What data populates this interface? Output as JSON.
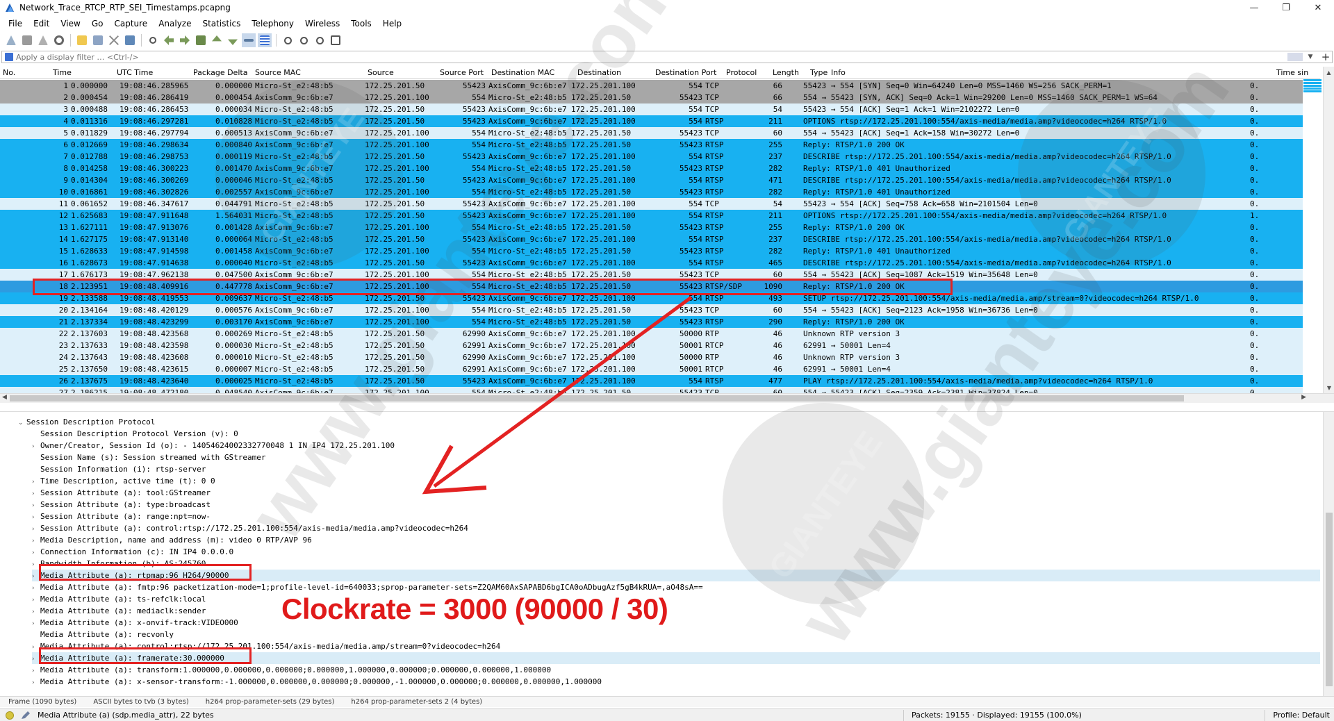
{
  "window": {
    "title": "Network_Trace_RTCP_RTP_SEI_Timestamps.pcapng",
    "controls": [
      "—",
      "❐",
      "✕"
    ]
  },
  "menu": [
    "File",
    "Edit",
    "View",
    "Go",
    "Capture",
    "Analyze",
    "Statistics",
    "Telephony",
    "Wireless",
    "Tools",
    "Help"
  ],
  "filter": {
    "placeholder": "Apply a display filter … <Ctrl-/>"
  },
  "columns": [
    "No.",
    "Time",
    "UTC Time",
    "Package Delta",
    "Source MAC",
    "Source",
    "Source Port",
    "Destination MAC",
    "Destination",
    "Destination Port",
    "Protocol",
    "Length",
    "Type",
    "Info",
    "Time sin"
  ],
  "packets": [
    {
      "no": "1",
      "time": "0.000000",
      "utc": "19:08:46.285965",
      "delta": "0.000000",
      "smac": "Micro-St_e2:48:b5",
      "src": "172.25.201.50",
      "sport": "55423",
      "dmac": "AxisComm_9c:6b:e7",
      "dst": "172.25.201.100",
      "dport": "554",
      "proto": "TCP",
      "len": "66",
      "type": "",
      "info": "55423 → 554 [SYN] Seq=0 Win=64240 Len=0 MSS=1460 WS=256 SACK_PERM=1",
      "tsince": "0.",
      "style": "gray"
    },
    {
      "no": "2",
      "time": "0.000454",
      "utc": "19:08:46.286419",
      "delta": "0.000454",
      "smac": "AxisComm_9c:6b:e7",
      "src": "172.25.201.100",
      "sport": "554",
      "dmac": "Micro-St_e2:48:b5",
      "dst": "172.25.201.50",
      "dport": "55423",
      "proto": "TCP",
      "len": "66",
      "type": "",
      "info": "554 → 55423 [SYN, ACK] Seq=0 Ack=1 Win=29200 Len=0 MSS=1460 SACK_PERM=1 WS=64",
      "tsince": "0.",
      "style": "gray"
    },
    {
      "no": "3",
      "time": "0.000488",
      "utc": "19:08:46.286453",
      "delta": "0.000034",
      "smac": "Micro-St_e2:48:b5",
      "src": "172.25.201.50",
      "sport": "55423",
      "dmac": "AxisComm_9c:6b:e7",
      "dst": "172.25.201.100",
      "dport": "554",
      "proto": "TCP",
      "len": "54",
      "type": "",
      "info": "55423 → 554 [ACK] Seq=1 Ack=1 Win=2102272 Len=0",
      "tsince": "0.",
      "style": "light"
    },
    {
      "no": "4",
      "time": "0.011316",
      "utc": "19:08:46.297281",
      "delta": "0.010828",
      "smac": "Micro-St_e2:48:b5",
      "src": "172.25.201.50",
      "sport": "55423",
      "dmac": "AxisComm_9c:6b:e7",
      "dst": "172.25.201.100",
      "dport": "554",
      "proto": "RTSP",
      "len": "211",
      "type": "",
      "info": "OPTIONS rtsp://172.25.201.100:554/axis-media/media.amp?videocodec=h264 RTSP/1.0",
      "tsince": "0.",
      "style": "blue"
    },
    {
      "no": "5",
      "time": "0.011829",
      "utc": "19:08:46.297794",
      "delta": "0.000513",
      "smac": "AxisComm_9c:6b:e7",
      "src": "172.25.201.100",
      "sport": "554",
      "dmac": "Micro-St_e2:48:b5",
      "dst": "172.25.201.50",
      "dport": "55423",
      "proto": "TCP",
      "len": "60",
      "type": "",
      "info": "554 → 55423 [ACK] Seq=1 Ack=158 Win=30272 Len=0",
      "tsince": "0.",
      "style": "light"
    },
    {
      "no": "6",
      "time": "0.012669",
      "utc": "19:08:46.298634",
      "delta": "0.000840",
      "smac": "AxisComm_9c:6b:e7",
      "src": "172.25.201.100",
      "sport": "554",
      "dmac": "Micro-St_e2:48:b5",
      "dst": "172.25.201.50",
      "dport": "55423",
      "proto": "RTSP",
      "len": "255",
      "type": "",
      "info": "Reply: RTSP/1.0 200 OK",
      "tsince": "0.",
      "style": "blue"
    },
    {
      "no": "7",
      "time": "0.012788",
      "utc": "19:08:46.298753",
      "delta": "0.000119",
      "smac": "Micro-St_e2:48:b5",
      "src": "172.25.201.50",
      "sport": "55423",
      "dmac": "AxisComm_9c:6b:e7",
      "dst": "172.25.201.100",
      "dport": "554",
      "proto": "RTSP",
      "len": "237",
      "type": "",
      "info": "DESCRIBE rtsp://172.25.201.100:554/axis-media/media.amp?videocodec=h264 RTSP/1.0",
      "tsince": "0.",
      "style": "blue"
    },
    {
      "no": "8",
      "time": "0.014258",
      "utc": "19:08:46.300223",
      "delta": "0.001470",
      "smac": "AxisComm_9c:6b:e7",
      "src": "172.25.201.100",
      "sport": "554",
      "dmac": "Micro-St_e2:48:b5",
      "dst": "172.25.201.50",
      "dport": "55423",
      "proto": "RTSP",
      "len": "282",
      "type": "",
      "info": "Reply: RTSP/1.0 401 Unauthorized",
      "tsince": "0.",
      "style": "blue"
    },
    {
      "no": "9",
      "time": "0.014304",
      "utc": "19:08:46.300269",
      "delta": "0.000046",
      "smac": "Micro-St_e2:48:b5",
      "src": "172.25.201.50",
      "sport": "55423",
      "dmac": "AxisComm_9c:6b:e7",
      "dst": "172.25.201.100",
      "dport": "554",
      "proto": "RTSP",
      "len": "471",
      "type": "",
      "info": "DESCRIBE rtsp://172.25.201.100:554/axis-media/media.amp?videocodec=h264 RTSP/1.0",
      "tsince": "0.",
      "style": "blue"
    },
    {
      "no": "10",
      "time": "0.016861",
      "utc": "19:08:46.302826",
      "delta": "0.002557",
      "smac": "AxisComm_9c:6b:e7",
      "src": "172.25.201.100",
      "sport": "554",
      "dmac": "Micro-St_e2:48:b5",
      "dst": "172.25.201.50",
      "dport": "55423",
      "proto": "RTSP",
      "len": "282",
      "type": "",
      "info": "Reply: RTSP/1.0 401 Unauthorized",
      "tsince": "0.",
      "style": "blue"
    },
    {
      "no": "11",
      "time": "0.061652",
      "utc": "19:08:46.347617",
      "delta": "0.044791",
      "smac": "Micro-St_e2:48:b5",
      "src": "172.25.201.50",
      "sport": "55423",
      "dmac": "AxisComm_9c:6b:e7",
      "dst": "172.25.201.100",
      "dport": "554",
      "proto": "TCP",
      "len": "54",
      "type": "",
      "info": "55423 → 554 [ACK] Seq=758 Ack=658 Win=2101504 Len=0",
      "tsince": "0.",
      "style": "light"
    },
    {
      "no": "12",
      "time": "1.625683",
      "utc": "19:08:47.911648",
      "delta": "1.564031",
      "smac": "Micro-St_e2:48:b5",
      "src": "172.25.201.50",
      "sport": "55423",
      "dmac": "AxisComm_9c:6b:e7",
      "dst": "172.25.201.100",
      "dport": "554",
      "proto": "RTSP",
      "len": "211",
      "type": "",
      "info": "OPTIONS rtsp://172.25.201.100:554/axis-media/media.amp?videocodec=h264 RTSP/1.0",
      "tsince": "1.",
      "style": "blue"
    },
    {
      "no": "13",
      "time": "1.627111",
      "utc": "19:08:47.913076",
      "delta": "0.001428",
      "smac": "AxisComm_9c:6b:e7",
      "src": "172.25.201.100",
      "sport": "554",
      "dmac": "Micro-St_e2:48:b5",
      "dst": "172.25.201.50",
      "dport": "55423",
      "proto": "RTSP",
      "len": "255",
      "type": "",
      "info": "Reply: RTSP/1.0 200 OK",
      "tsince": "0.",
      "style": "blue"
    },
    {
      "no": "14",
      "time": "1.627175",
      "utc": "19:08:47.913140",
      "delta": "0.000064",
      "smac": "Micro-St_e2:48:b5",
      "src": "172.25.201.50",
      "sport": "55423",
      "dmac": "AxisComm_9c:6b:e7",
      "dst": "172.25.201.100",
      "dport": "554",
      "proto": "RTSP",
      "len": "237",
      "type": "",
      "info": "DESCRIBE rtsp://172.25.201.100:554/axis-media/media.amp?videocodec=h264 RTSP/1.0",
      "tsince": "0.",
      "style": "blue"
    },
    {
      "no": "15",
      "time": "1.628633",
      "utc": "19:08:47.914598",
      "delta": "0.001458",
      "smac": "AxisComm_9c:6b:e7",
      "src": "172.25.201.100",
      "sport": "554",
      "dmac": "Micro-St_e2:48:b5",
      "dst": "172.25.201.50",
      "dport": "55423",
      "proto": "RTSP",
      "len": "282",
      "type": "",
      "info": "Reply: RTSP/1.0 401 Unauthorized",
      "tsince": "0.",
      "style": "blue"
    },
    {
      "no": "16",
      "time": "1.628673",
      "utc": "19:08:47.914638",
      "delta": "0.000040",
      "smac": "Micro-St_e2:48:b5",
      "src": "172.25.201.50",
      "sport": "55423",
      "dmac": "AxisComm_9c:6b:e7",
      "dst": "172.25.201.100",
      "dport": "554",
      "proto": "RTSP",
      "len": "465",
      "type": "",
      "info": "DESCRIBE rtsp://172.25.201.100:554/axis-media/media.amp?videocodec=h264 RTSP/1.0",
      "tsince": "0.",
      "style": "blue"
    },
    {
      "no": "17",
      "time": "1.676173",
      "utc": "19:08:47.962138",
      "delta": "0.047500",
      "smac": "AxisComm_9c:6b:e7",
      "src": "172.25.201.100",
      "sport": "554",
      "dmac": "Micro-St_e2:48:b5",
      "dst": "172.25.201.50",
      "dport": "55423",
      "proto": "TCP",
      "len": "60",
      "type": "",
      "info": "554 → 55423 [ACK] Seq=1087 Ack=1519 Win=35648 Len=0",
      "tsince": "0.",
      "style": "light"
    },
    {
      "no": "18",
      "time": "2.123951",
      "utc": "19:08:48.409916",
      "delta": "0.447778",
      "smac": "AxisComm_9c:6b:e7",
      "src": "172.25.201.100",
      "sport": "554",
      "dmac": "Micro-St_e2:48:b5",
      "dst": "172.25.201.50",
      "dport": "55423",
      "proto": "RTSP/SDP",
      "len": "1090",
      "type": "",
      "info": "Reply: RTSP/1.0 200 OK",
      "tsince": "0.",
      "style": "sel"
    },
    {
      "no": "19",
      "time": "2.133588",
      "utc": "19:08:48.419553",
      "delta": "0.009637",
      "smac": "Micro-St_e2:48:b5",
      "src": "172.25.201.50",
      "sport": "55423",
      "dmac": "AxisComm_9c:6b:e7",
      "dst": "172.25.201.100",
      "dport": "554",
      "proto": "RTSP",
      "len": "493",
      "type": "",
      "info": "SETUP rtsp://172.25.201.100:554/axis-media/media.amp/stream=0?videocodec=h264 RTSP/1.0",
      "tsince": "0.",
      "style": "blue"
    },
    {
      "no": "20",
      "time": "2.134164",
      "utc": "19:08:48.420129",
      "delta": "0.000576",
      "smac": "AxisComm_9c:6b:e7",
      "src": "172.25.201.100",
      "sport": "554",
      "dmac": "Micro-St_e2:48:b5",
      "dst": "172.25.201.50",
      "dport": "55423",
      "proto": "TCP",
      "len": "60",
      "type": "",
      "info": "554 → 55423 [ACK] Seq=2123 Ack=1958 Win=36736 Len=0",
      "tsince": "0.",
      "style": "light"
    },
    {
      "no": "21",
      "time": "2.137334",
      "utc": "19:08:48.423299",
      "delta": "0.003170",
      "smac": "AxisComm_9c:6b:e7",
      "src": "172.25.201.100",
      "sport": "554",
      "dmac": "Micro-St_e2:48:b5",
      "dst": "172.25.201.50",
      "dport": "55423",
      "proto": "RTSP",
      "len": "290",
      "type": "",
      "info": "Reply: RTSP/1.0 200 OK",
      "tsince": "0.",
      "style": "blue"
    },
    {
      "no": "22",
      "time": "2.137603",
      "utc": "19:08:48.423568",
      "delta": "0.000269",
      "smac": "Micro-St_e2:48:b5",
      "src": "172.25.201.50",
      "sport": "62990",
      "dmac": "AxisComm_9c:6b:e7",
      "dst": "172.25.201.100",
      "dport": "50000",
      "proto": "RTP",
      "len": "46",
      "type": "",
      "info": "Unknown RTP version 3",
      "tsince": "0.",
      "style": "light"
    },
    {
      "no": "23",
      "time": "2.137633",
      "utc": "19:08:48.423598",
      "delta": "0.000030",
      "smac": "Micro-St_e2:48:b5",
      "src": "172.25.201.50",
      "sport": "62991",
      "dmac": "AxisComm_9c:6b:e7",
      "dst": "172.25.201.100",
      "dport": "50001",
      "proto": "RTCP",
      "len": "46",
      "type": "",
      "info": "62991 → 50001 Len=4",
      "tsince": "0.",
      "style": "light"
    },
    {
      "no": "24",
      "time": "2.137643",
      "utc": "19:08:48.423608",
      "delta": "0.000010",
      "smac": "Micro-St_e2:48:b5",
      "src": "172.25.201.50",
      "sport": "62990",
      "dmac": "AxisComm_9c:6b:e7",
      "dst": "172.25.201.100",
      "dport": "50000",
      "proto": "RTP",
      "len": "46",
      "type": "",
      "info": "Unknown RTP version 3",
      "tsince": "0.",
      "style": "light"
    },
    {
      "no": "25",
      "time": "2.137650",
      "utc": "19:08:48.423615",
      "delta": "0.000007",
      "smac": "Micro-St_e2:48:b5",
      "src": "172.25.201.50",
      "sport": "62991",
      "dmac": "AxisComm_9c:6b:e7",
      "dst": "172.25.201.100",
      "dport": "50001",
      "proto": "RTCP",
      "len": "46",
      "type": "",
      "info": "62991 → 50001 Len=4",
      "tsince": "0.",
      "style": "light"
    },
    {
      "no": "26",
      "time": "2.137675",
      "utc": "19:08:48.423640",
      "delta": "0.000025",
      "smac": "Micro-St_e2:48:b5",
      "src": "172.25.201.50",
      "sport": "55423",
      "dmac": "AxisComm_9c:6b:e7",
      "dst": "172.25.201.100",
      "dport": "554",
      "proto": "RTSP",
      "len": "477",
      "type": "",
      "info": "PLAY rtsp://172.25.201.100:554/axis-media/media.amp?videocodec=h264 RTSP/1.0",
      "tsince": "0.",
      "style": "blue"
    },
    {
      "no": "27",
      "time": "2.186215",
      "utc": "19:08:48.472180",
      "delta": "0.048540",
      "smac": "AxisComm_9c:6b:e7",
      "src": "172.25.201.100",
      "sport": "554",
      "dmac": "Micro-St_e2:48:b5",
      "dst": "172.25.201.50",
      "dport": "55423",
      "proto": "TCP",
      "len": "60",
      "type": "",
      "info": "554 → 55423 [ACK] Seq=2359 Ack=2381 Win=37824 Len=0",
      "tsince": "0.",
      "style": "light"
    }
  ],
  "details": [
    {
      "text": "Session Description Protocol",
      "indent": 0,
      "arrow": "down"
    },
    {
      "text": "Session Description Protocol Version (v): 0",
      "indent": 2,
      "arrow": ""
    },
    {
      "text": "Owner/Creator, Session Id (o): - 14054624002332770048 1 IN IP4 172.25.201.100",
      "indent": 1,
      "arrow": "right"
    },
    {
      "text": "Session Name (s): Session streamed with GStreamer",
      "indent": 2,
      "arrow": ""
    },
    {
      "text": "Session Information (i): rtsp-server",
      "indent": 2,
      "arrow": ""
    },
    {
      "text": "Time Description, active time (t): 0 0",
      "indent": 1,
      "arrow": "right"
    },
    {
      "text": "Session Attribute (a): tool:GStreamer",
      "indent": 1,
      "arrow": "right"
    },
    {
      "text": "Session Attribute (a): type:broadcast",
      "indent": 1,
      "arrow": "right"
    },
    {
      "text": "Session Attribute (a): range:npt=now-",
      "indent": 1,
      "arrow": "right"
    },
    {
      "text": "Session Attribute (a): control:rtsp://172.25.201.100:554/axis-media/media.amp?videocodec=h264",
      "indent": 1,
      "arrow": "right"
    },
    {
      "text": "Media Description, name and address (m): video 0 RTP/AVP 96",
      "indent": 1,
      "arrow": "right"
    },
    {
      "text": "Connection Information (c): IN IP4 0.0.0.0",
      "indent": 1,
      "arrow": "right"
    },
    {
      "text": "Bandwidth Information (b): AS:245760",
      "indent": 1,
      "arrow": "right"
    },
    {
      "text": "Media Attribute (a): rtpmap:96 H264/90000",
      "indent": 1,
      "arrow": "right",
      "hl": true
    },
    {
      "text": "Media Attribute (a): fmtp:96 packetization-mode=1;profile-level-id=640033;sprop-parameter-sets=Z2QAM60AxSAPABD6bgICA0oADbugAzf5gB4kRUA=,aO48sA==",
      "indent": 1,
      "arrow": "right"
    },
    {
      "text": "Media Attribute (a): ts-refclk:local",
      "indent": 1,
      "arrow": "right"
    },
    {
      "text": "Media Attribute (a): mediaclk:sender",
      "indent": 1,
      "arrow": "right"
    },
    {
      "text": "Media Attribute (a): x-onvif-track:VIDEO000",
      "indent": 1,
      "arrow": "right"
    },
    {
      "text": "Media Attribute (a): recvonly",
      "indent": 2,
      "arrow": ""
    },
    {
      "text": "Media Attribute (a): control:rtsp://172.25.201.100:554/axis-media/media.amp/stream=0?videocodec=h264",
      "indent": 1,
      "arrow": "right"
    },
    {
      "text": "Media Attribute (a): framerate:30.000000",
      "indent": 1,
      "arrow": "right",
      "hl": true
    },
    {
      "text": "Media Attribute (a): transform:1.000000,0.000000,0.000000;0.000000,1.000000,0.000000;0.000000,0.000000,1.000000",
      "indent": 1,
      "arrow": "right"
    },
    {
      "text": "Media Attribute (a): x-sensor-transform:-1.000000,0.000000,0.000000;0.000000,-1.000000,0.000000;0.000000,0.000000,1.000000",
      "indent": 1,
      "arrow": "right"
    }
  ],
  "byte_tabs": [
    "Frame (1090 bytes)",
    "ASCII bytes to tvb (3 bytes)",
    "h264 prop-parameter-sets (29 bytes)",
    "h264 prop-parameter-sets 2 (4 bytes)"
  ],
  "status": {
    "message": "Media Attribute (a) (sdp.media_attr), 22 bytes",
    "packets": "Packets: 19155 · Displayed: 19155 (100.0%)",
    "profile": "Profile: Default"
  },
  "annotation": {
    "text": "Clockrate = 3000 (90000 / 30)",
    "color": "#e01a1a"
  },
  "watermark": {
    "text": "www.gianteye.com",
    "logo": "GIANTEYE"
  },
  "colors": {
    "row_gray": "#a7a7a7",
    "row_blue": "#18b1f1",
    "row_light": "#def0fa",
    "row_selected": "#2d9be0",
    "annotation_red": "#e32222"
  }
}
